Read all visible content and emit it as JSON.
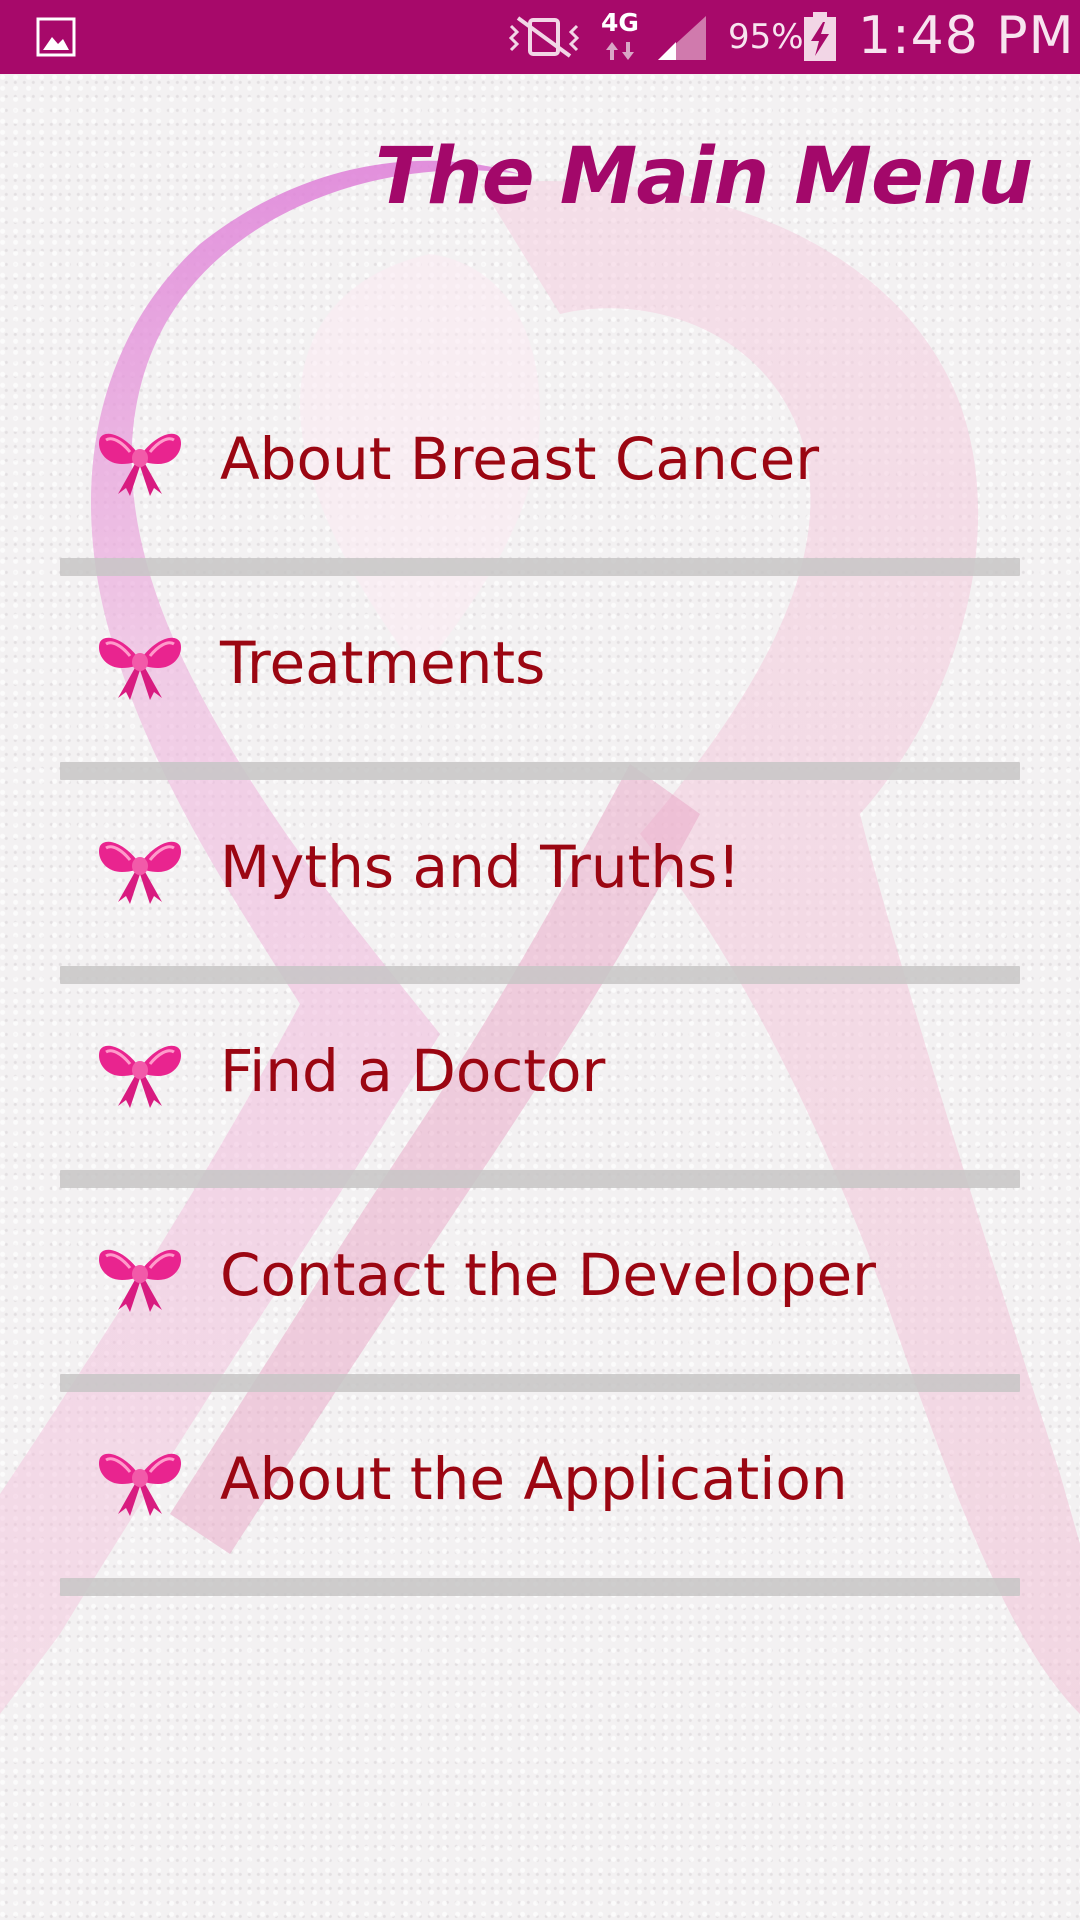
{
  "status_bar": {
    "gallery_icon": "image-icon",
    "vibrate_icon": "vibrate-off-icon",
    "network": "4G",
    "signal_icon": "signal-bars-icon",
    "battery_percent": "95%",
    "battery_icon": "battery-charging-icon",
    "time": "1:48 PM",
    "bar_color": "#a7096a"
  },
  "header": {
    "title": "The Main Menu",
    "title_color": "#a3086a"
  },
  "menu": {
    "icon": "bow-icon",
    "label_color": "#9b0612",
    "items": [
      {
        "label": "About Breast Cancer"
      },
      {
        "label": "Treatments"
      },
      {
        "label": "Myths and Truths!"
      },
      {
        "label": "Find a Doctor"
      },
      {
        "label": "Contact the Developer"
      },
      {
        "label": "About the Application"
      }
    ]
  }
}
